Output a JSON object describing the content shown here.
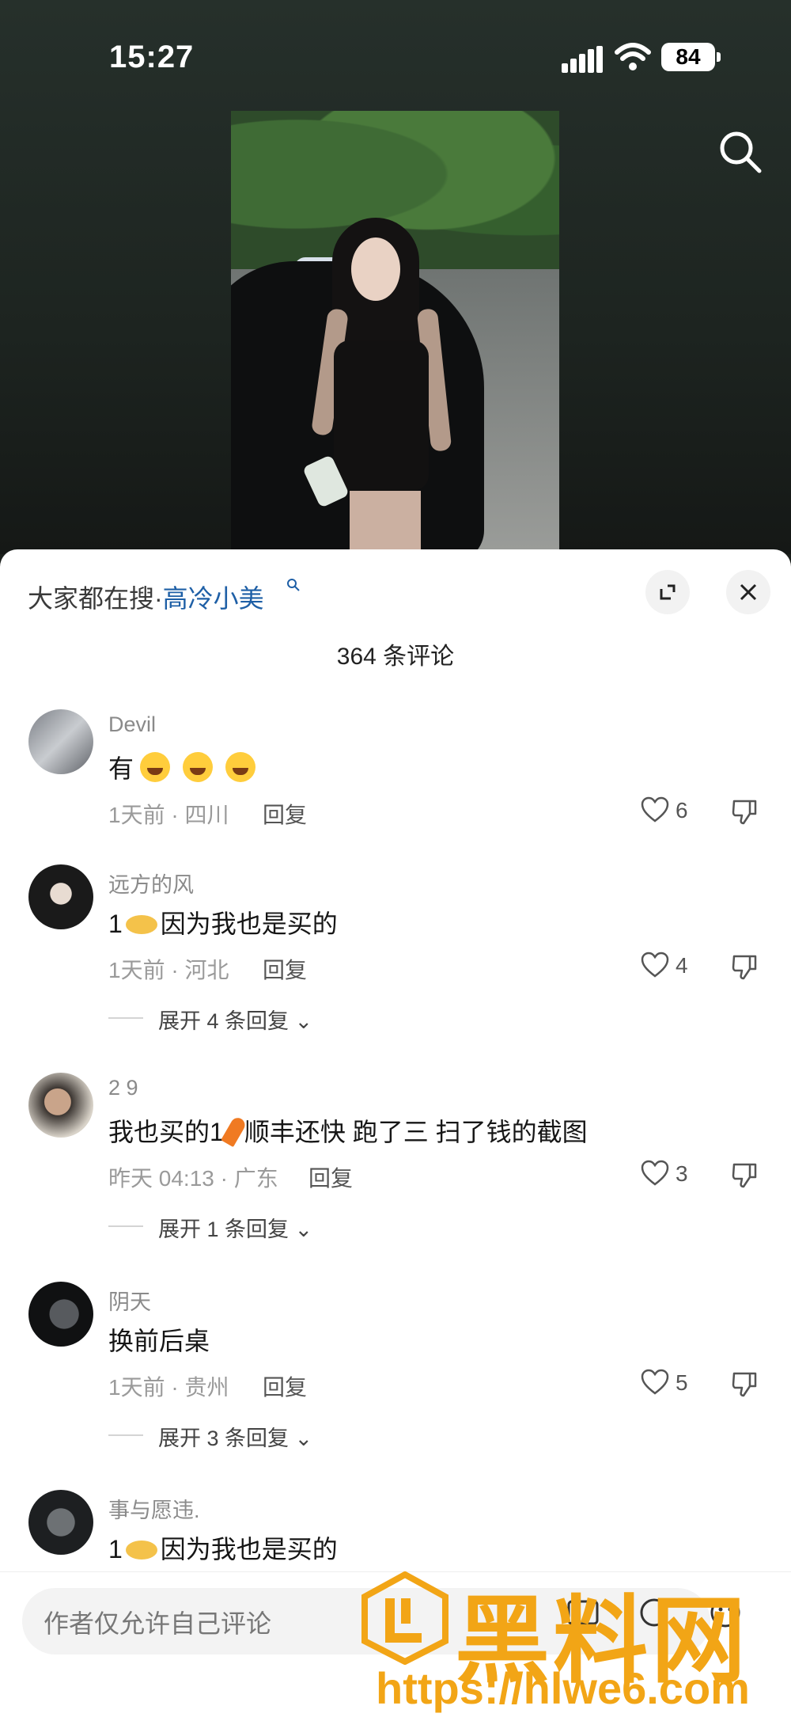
{
  "status_bar": {
    "time": "15:27",
    "battery": "84"
  },
  "sheet": {
    "hot_search_prefix": "大家都在搜·",
    "hot_search_keyword": "高冷小美",
    "comment_count": "364 条评论"
  },
  "comments": [
    {
      "username": "Devil",
      "text_prefix": "有",
      "time_loc": "1天前 · 四川",
      "reply": "回复",
      "likes": "6"
    },
    {
      "username": "远方的风",
      "text_prefix": "1",
      "text_suffix": "因为我也是买的",
      "time_loc": "1天前 · 河北",
      "reply": "回复",
      "likes": "4",
      "expand": "展开 4 条回复"
    },
    {
      "username": "2 9",
      "text_prefix": "我也买的1",
      "text_suffix": "顺丰还快 跑了三   扫了钱的截图",
      "time_loc": "昨天 04:13 · 广东",
      "reply": "回复",
      "likes": "3",
      "expand": "展开 1 条回复"
    },
    {
      "username": "阴天",
      "text_prefix": "换前后桌",
      "time_loc": "1天前 · 贵州",
      "reply": "回复",
      "likes": "5",
      "expand": "展开 3 条回复"
    },
    {
      "username": "事与愿违.",
      "text_prefix": "1",
      "text_suffix": "因为我也是买的"
    }
  ],
  "input": {
    "placeholder": "作者仅允许自己评论"
  },
  "watermark": {
    "text": "黑料网",
    "url": "https://hlwe6.com"
  },
  "colors": {
    "accent_link": "#1e5fa6",
    "watermark": "#f2a516"
  }
}
